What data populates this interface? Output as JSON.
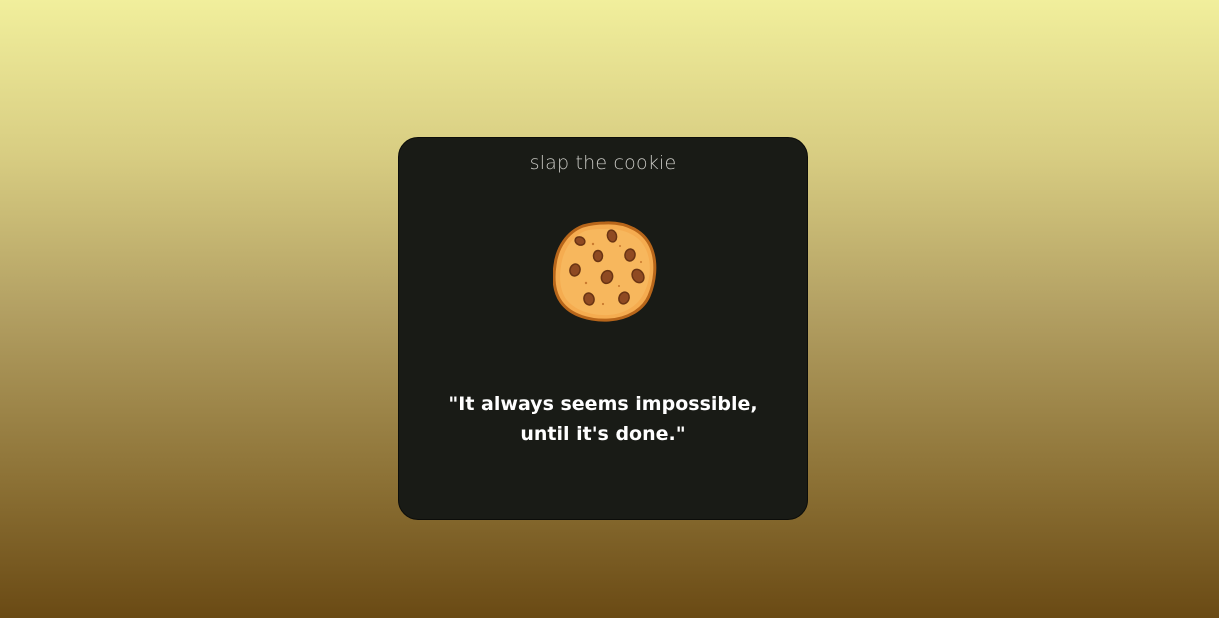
{
  "page": {
    "background_top": "#f1ef9c",
    "background_bottom": "#6a4a14"
  },
  "card": {
    "background": "#191b16",
    "title": "slap the cookie",
    "cookie_icon": "cookie-icon",
    "quote": {
      "line1": "\"It always seems impossible,",
      "line2": "until it's done.\""
    }
  }
}
